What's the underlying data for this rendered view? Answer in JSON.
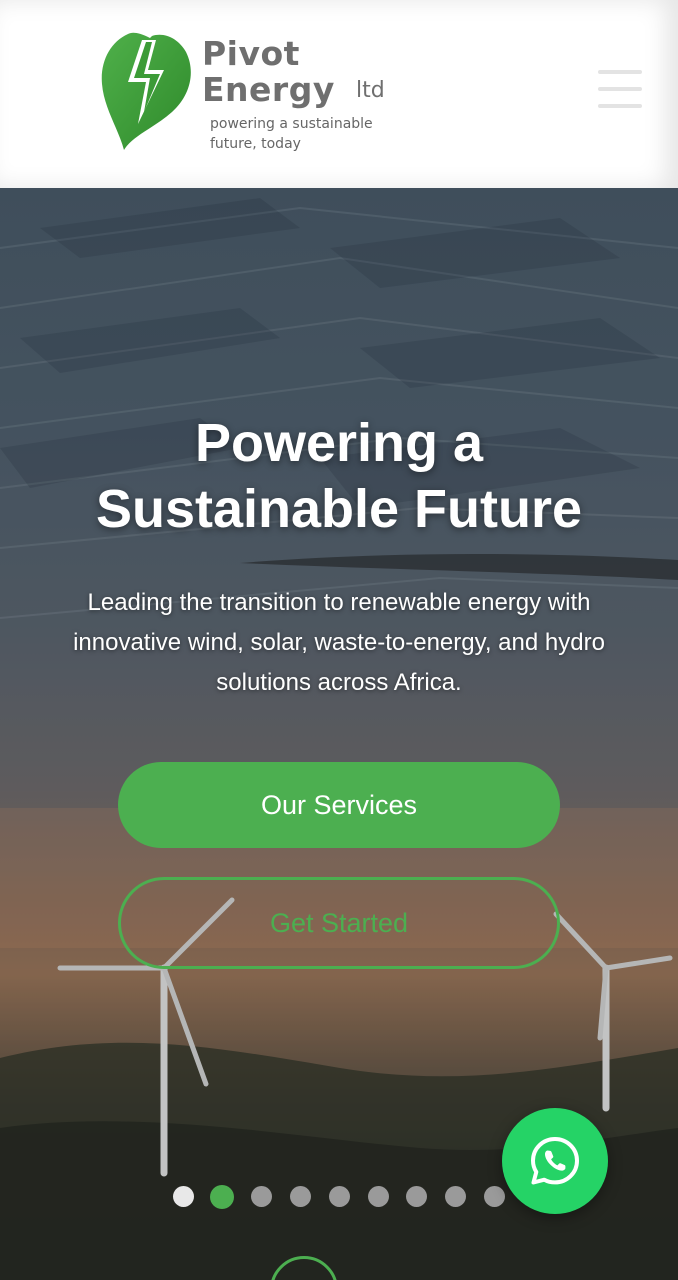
{
  "brand": {
    "name_line1": "Pivot",
    "name_line2": "Energy",
    "suffix": "ltd",
    "tagline_line1": "powering a sustainable",
    "tagline_line2": "future, today",
    "accent": "#4caf50"
  },
  "header": {
    "menu_icon": "hamburger-menu-icon"
  },
  "hero": {
    "title_line1": "Powering a",
    "title_line2": "Sustainable Future",
    "subtitle_line1": "Leading the transition to renewable energy with",
    "subtitle_line2": "innovative wind, solar, waste-to-energy, and hydro",
    "subtitle_line3": "solutions across Africa.",
    "primary_button": "Our Services",
    "secondary_button": "Get Started",
    "slides": {
      "count": 9,
      "active_index": 1
    }
  },
  "floating": {
    "whatsapp_icon": "whatsapp-icon",
    "whatsapp_color": "#25d366"
  }
}
